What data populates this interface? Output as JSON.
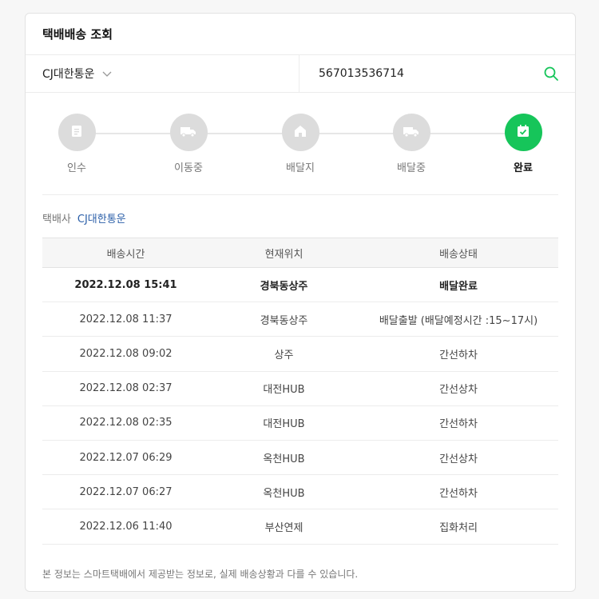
{
  "header": {
    "title": "택배배송 조회"
  },
  "search": {
    "carrier": "CJ대한통운",
    "tracking_number": "567013536714"
  },
  "steps": [
    {
      "label": "인수",
      "icon": "receipt-icon",
      "active": false
    },
    {
      "label": "이동중",
      "icon": "truck-icon",
      "active": false
    },
    {
      "label": "배달지",
      "icon": "home-icon",
      "active": false
    },
    {
      "label": "배달중",
      "icon": "truck-icon",
      "active": false
    },
    {
      "label": "완료",
      "icon": "check-calendar-icon",
      "active": true
    }
  ],
  "carrier_info": {
    "label": "택배사",
    "value": "CJ대한통운"
  },
  "table": {
    "headers": [
      "배송시간",
      "현재위치",
      "배송상태"
    ],
    "rows": [
      [
        "2022.12.08 15:41",
        "경북동상주",
        "배달완료"
      ],
      [
        "2022.12.08 11:37",
        "경북동상주",
        "배달출발 (배달예정시간 :15~17시)"
      ],
      [
        "2022.12.08 09:02",
        "상주",
        "간선하차"
      ],
      [
        "2022.12.08 02:37",
        "대전HUB",
        "간선상차"
      ],
      [
        "2022.12.08 02:35",
        "대전HUB",
        "간선하차"
      ],
      [
        "2022.12.07 06:29",
        "옥천HUB",
        "간선상차"
      ],
      [
        "2022.12.07 06:27",
        "옥천HUB",
        "간선하차"
      ],
      [
        "2022.12.06 11:40",
        "부산연제",
        "집화처리"
      ]
    ]
  },
  "footnote": "본 정보는 스마트택배에서 제공받는 정보로, 실제 배송상황과 다를 수 있습니다.",
  "colors": {
    "accent": "#16c55a",
    "link": "#2a5ea8",
    "inactive": "#dcdcdc"
  }
}
